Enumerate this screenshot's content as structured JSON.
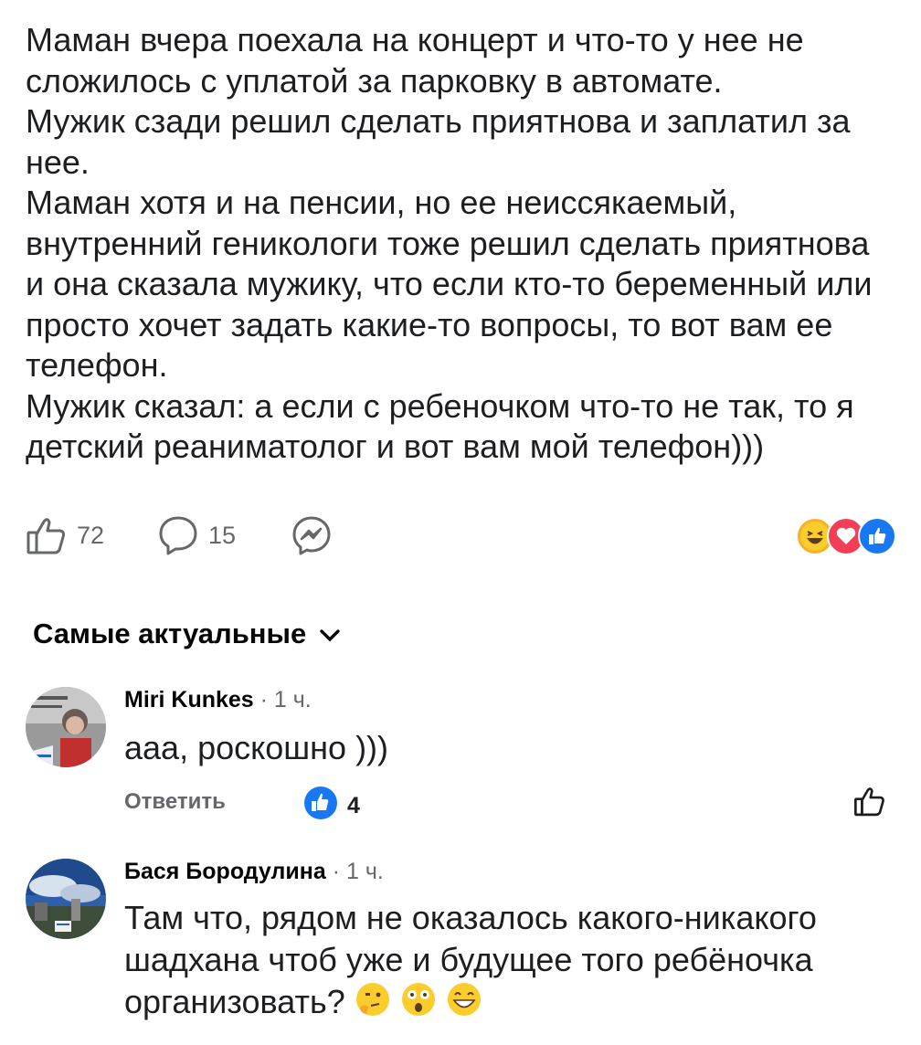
{
  "post": {
    "lines": [
      "Маман вчера поехала на концерт и что-то у нее не",
      "сложилось с уплатой за парковку в автомате.",
      "Мужик сзади решил сделать приятнова и заплатил за",
      "нее.",
      "Маман хотя и на пенсии, но ее неиссякаемый,",
      "внутренний геникологи тоже решил сделать приятнова",
      "и она сказала мужику, что если кто-то беременный или",
      "просто хочет задать какие-то вопросы, то вот вам ее",
      "телефон.",
      "Мужик сказал: а если с ребеночком что-то не так, то я",
      "детский реаниматолог и вот вам мой телефон)))"
    ],
    "likes": "72",
    "comments": "15",
    "icons": [
      "like-icon",
      "comment-icon",
      "messenger-icon"
    ],
    "reaction_icons": [
      "haha-icon",
      "love-icon",
      "like-reaction-icon"
    ]
  },
  "sort": {
    "label": "Самые актуальные"
  },
  "comments": [
    {
      "name": "Miri Kunkes",
      "time": "· 1 ч.",
      "text": "ааа, роскошно )))",
      "reply": "Ответить",
      "likes": "4"
    },
    {
      "name": "Бася Бородулина",
      "time": "· 1 ч.",
      "text_lines": [
        "Там что, рядом не оказалось какого-никакого",
        "шадхана чтоб уже и будущее того ребёночка",
        "организовать?"
      ]
    }
  ],
  "colors": {
    "accent": "#1877f2",
    "muted": "#65676b",
    "love": "#f33e58"
  }
}
